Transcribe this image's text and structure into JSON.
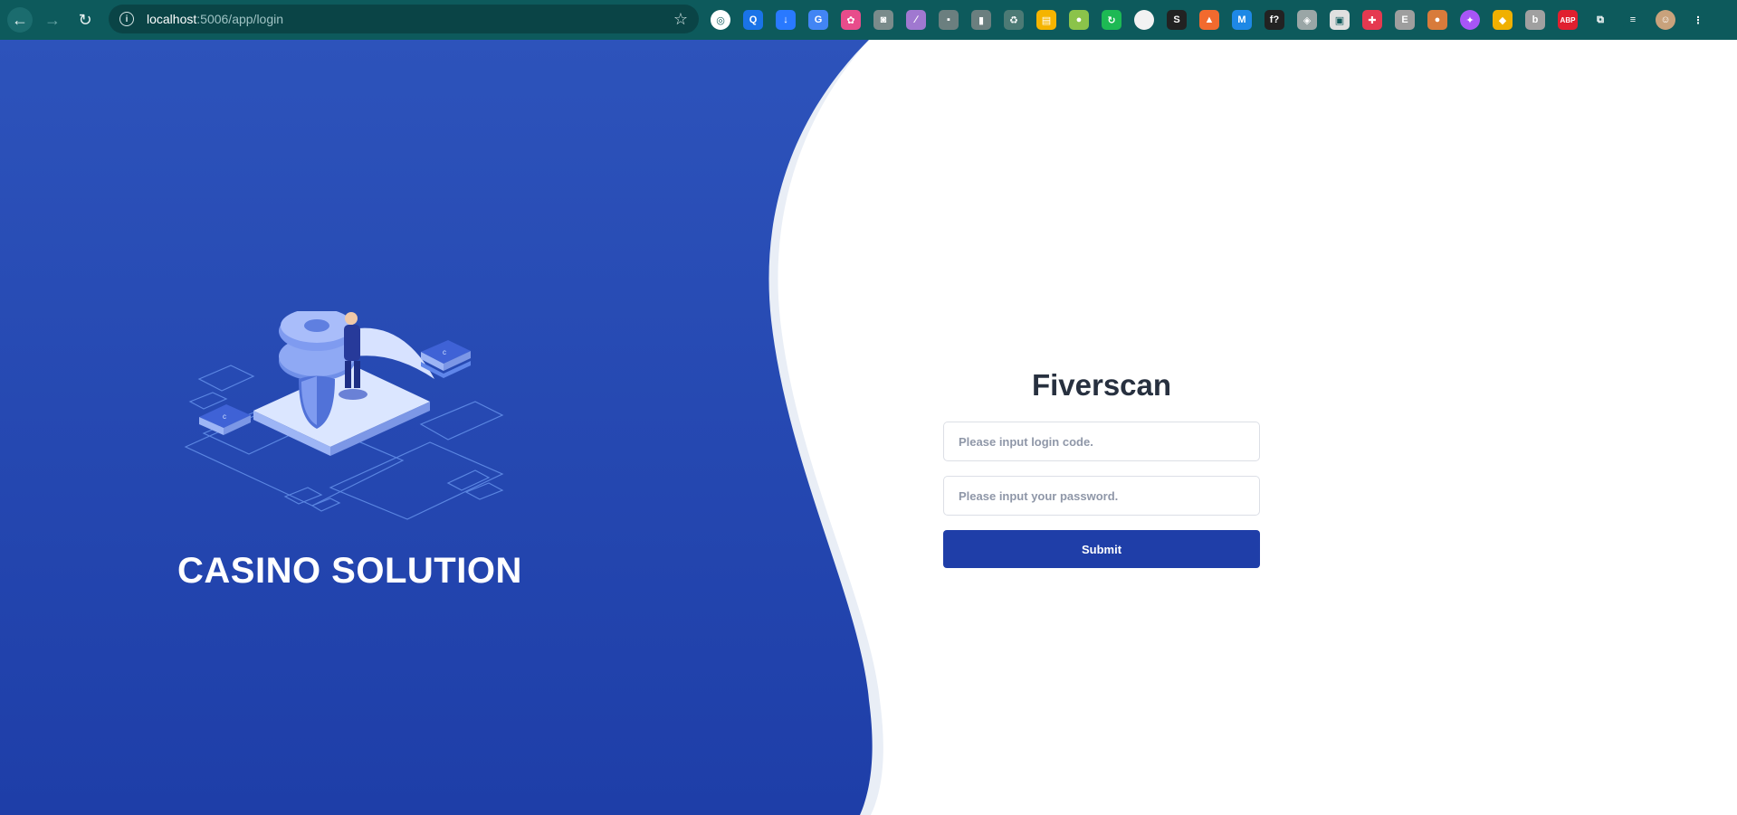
{
  "browser": {
    "url_host": "localhost",
    "url_rest": ":5006/app/login",
    "extensions": [
      {
        "icon": "chrome-app-icon",
        "color": "#ffffff",
        "glyph": "◎"
      },
      {
        "icon": "search-ext-icon",
        "color": "#1a73e8",
        "glyph": "Q"
      },
      {
        "icon": "download-ext-icon",
        "color": "#2979ff",
        "glyph": "↓"
      },
      {
        "icon": "translate-ext-icon",
        "color": "#4285f4",
        "glyph": "G"
      },
      {
        "icon": "color-picker-icon",
        "color": "#e84c8b",
        "glyph": "✿"
      },
      {
        "icon": "camera-ext-icon",
        "color": "#7a8b8b",
        "glyph": "◙"
      },
      {
        "icon": "feather-ext-icon",
        "color": "#a078d0",
        "glyph": "∕"
      },
      {
        "icon": "shield-ext-icon",
        "color": "#6b7f7f",
        "glyph": "▪"
      },
      {
        "icon": "bottle-ext-icon",
        "color": "#6b7f7f",
        "glyph": "▮"
      },
      {
        "icon": "recycle-ext-icon",
        "color": "#4c7a75",
        "glyph": "♻"
      },
      {
        "icon": "note-ext-icon",
        "color": "#f5b400",
        "glyph": "▤"
      },
      {
        "icon": "bulb-ext-icon",
        "color": "#8bc34a",
        "glyph": "●"
      },
      {
        "icon": "refresh-ext-icon",
        "color": "#1db954",
        "glyph": "↻"
      },
      {
        "icon": "blank-ext-icon",
        "color": "#f2f2f2",
        "glyph": ""
      },
      {
        "icon": "s-ext-icon",
        "color": "#222222",
        "glyph": "S"
      },
      {
        "icon": "rocket-ext-icon",
        "color": "#f26a2e",
        "glyph": "▲"
      },
      {
        "icon": "m-ext-icon",
        "color": "#1e88e5",
        "glyph": "M"
      },
      {
        "icon": "fx-ext-icon",
        "color": "#222222",
        "glyph": "f?"
      },
      {
        "icon": "guard-ext-icon",
        "color": "#9aa6a6",
        "glyph": "◈"
      },
      {
        "icon": "frame-ext-icon",
        "color": "#e0e0e0",
        "glyph": "▣"
      },
      {
        "icon": "pin-ext-icon",
        "color": "#e53950",
        "glyph": "✚"
      },
      {
        "icon": "grey-ext-icon",
        "color": "#9e9e9e",
        "glyph": "E"
      },
      {
        "icon": "cookie-ext-icon",
        "color": "#d87b3b",
        "glyph": "●"
      },
      {
        "icon": "brain-ext-icon",
        "color": "#a855f7",
        "glyph": "✦"
      },
      {
        "icon": "cube-ext-icon",
        "color": "#f0b000",
        "glyph": "◆"
      },
      {
        "icon": "b-ext-icon",
        "color": "#a0a0a0",
        "glyph": "b"
      },
      {
        "icon": "abp-ext-icon",
        "color": "#e0202f",
        "glyph": "ABP"
      },
      {
        "icon": "puzzle-ext-icon",
        "color": "#0d5a5c",
        "glyph": "⧉"
      },
      {
        "icon": "playlist-ext-icon",
        "color": "#0d5a5c",
        "glyph": "≡"
      },
      {
        "icon": "avatar-icon",
        "color": "#c9a27c",
        "glyph": "☺"
      },
      {
        "icon": "menu-dots-icon",
        "color": "#0d5a5c",
        "glyph": "⋮"
      }
    ]
  },
  "hero": {
    "brand_text": "CASINO SOLUTION",
    "background_color": "#2a4fbe"
  },
  "login": {
    "title": "Fiverscan",
    "code_placeholder": "Please input login code.",
    "password_placeholder": "Please input your password.",
    "submit_label": "Submit",
    "accent": "#1f3ea8"
  }
}
